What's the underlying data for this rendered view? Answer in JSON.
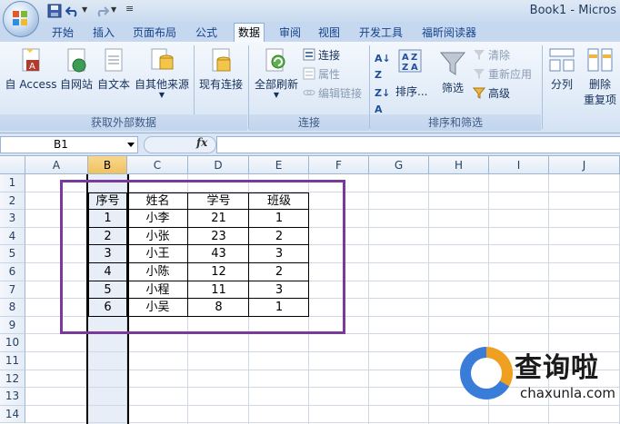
{
  "window": {
    "title": "Book1 - Micros"
  },
  "tabs": [
    "开始",
    "插入",
    "页面布局",
    "公式",
    "数据",
    "审阅",
    "视图",
    "开发工具",
    "福昕阅读器"
  ],
  "active_tab": "数据",
  "ribbon": {
    "external_data": {
      "group_label": "获取外部数据",
      "buttons": [
        "自 Access",
        "自网站",
        "自文本",
        "自其他来源",
        "现有连接"
      ]
    },
    "connections": {
      "group_label": "连接",
      "refresh_all": "全部刷新",
      "connections": "连接",
      "properties": "属性",
      "edit_links": "编辑链接"
    },
    "sort_filter": {
      "group_label": "排序和筛选",
      "sort": "排序...",
      "filter": "筛选",
      "clear": "清除",
      "reapply": "重新应用",
      "advanced": "高级"
    },
    "data_tools": {
      "split_columns": "分列",
      "remove_duplicates_1": "删除",
      "remove_duplicates_2": "重复项"
    }
  },
  "formula_bar": {
    "name_box": "B1",
    "fx": "fx",
    "value": ""
  },
  "columns": [
    "A",
    "B",
    "C",
    "D",
    "E",
    "F",
    "G",
    "H",
    "I",
    "J"
  ],
  "selected_column": "B",
  "rows": [
    "1",
    "2",
    "3",
    "4",
    "5",
    "6",
    "7",
    "8",
    "9",
    "10",
    "11",
    "12",
    "13",
    "14"
  ],
  "table": {
    "headers": [
      "序号",
      "姓名",
      "学号",
      "班级"
    ],
    "rows": [
      [
        "1",
        "小李",
        "21",
        "1"
      ],
      [
        "2",
        "小张",
        "23",
        "2"
      ],
      [
        "3",
        "小王",
        "43",
        "3"
      ],
      [
        "4",
        "小陈",
        "12",
        "2"
      ],
      [
        "5",
        "小程",
        "11",
        "3"
      ],
      [
        "6",
        "小吴",
        "8",
        "1"
      ]
    ]
  },
  "watermark": {
    "title": "查询啦",
    "subtitle": "chaxunla.com"
  },
  "colors": {
    "selection_outline": "#7a3a9c",
    "ribbon_text": "#15428b"
  }
}
